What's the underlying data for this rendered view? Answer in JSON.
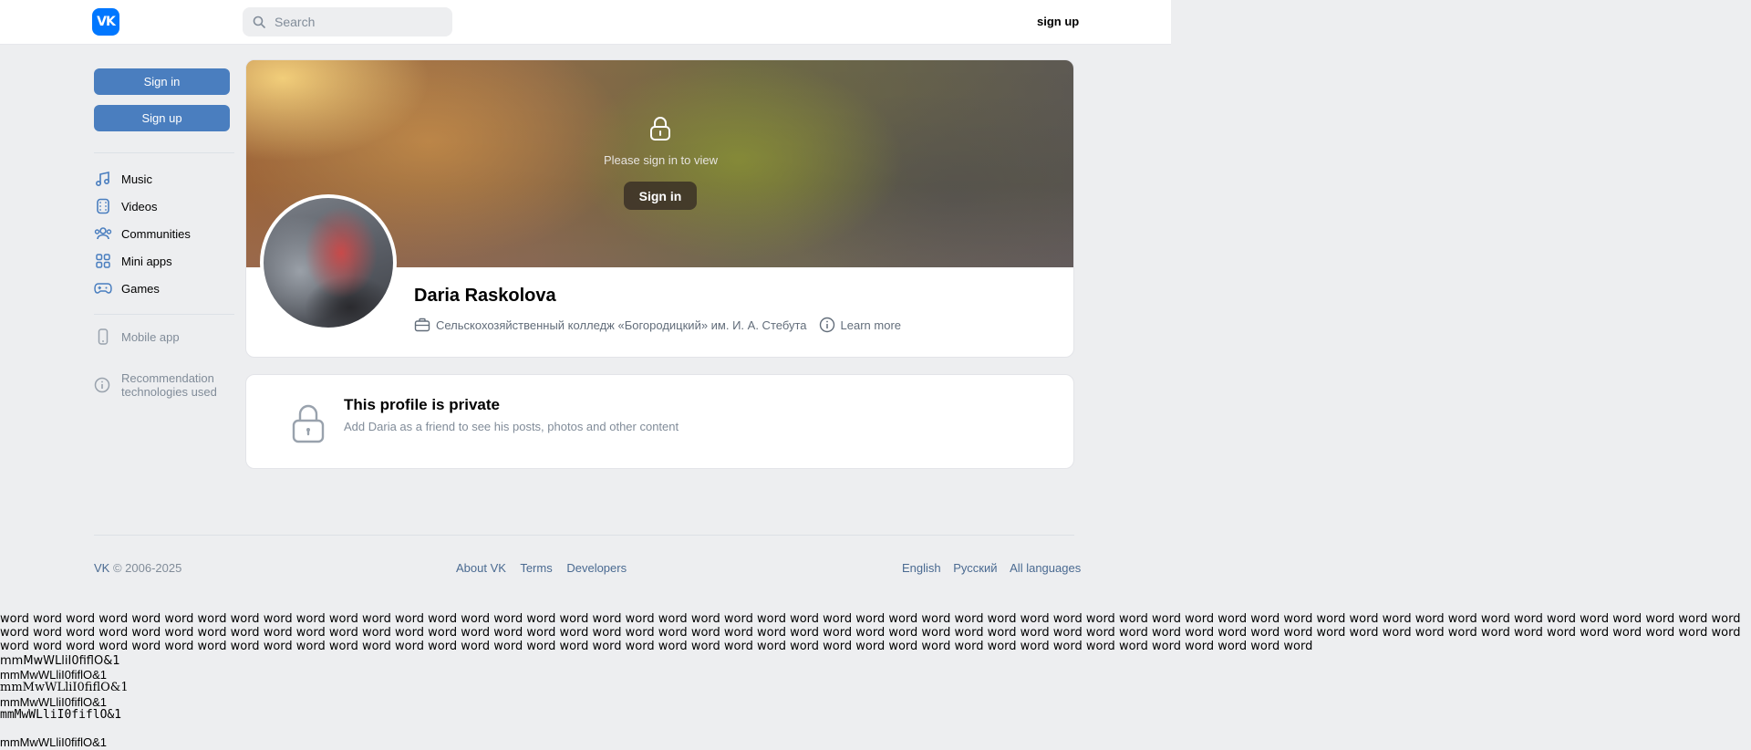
{
  "header": {
    "logo": "VK",
    "search_placeholder": "Search",
    "signup_label": "sign up"
  },
  "sidebar": {
    "signin_label": "Sign in",
    "signup_label": "Sign up",
    "items": [
      {
        "label": "Music",
        "icon": "music-icon"
      },
      {
        "label": "Videos",
        "icon": "video-icon"
      },
      {
        "label": "Communities",
        "icon": "communities-icon"
      },
      {
        "label": "Mini apps",
        "icon": "mini-apps-icon"
      },
      {
        "label": "Games",
        "icon": "gamepad-icon"
      }
    ],
    "mobile_app": "Mobile app",
    "recommendation_line1": "Recommendation",
    "recommendation_line2": "technologies used"
  },
  "profile": {
    "lock_message": "Please sign in to view",
    "cover_signin": "Sign in",
    "name": "Daria Raskolova",
    "workplace": "Сельскохозяйственный колледж «Богородицкий» им. И. А. Стебута",
    "learn_more": "Learn more"
  },
  "private": {
    "title": "This profile is private",
    "subtitle": "Add Daria as a friend to see his posts, photos and other content"
  },
  "footer": {
    "vk": "VK",
    "copyright": "© 2006-2025",
    "about": "About VK",
    "terms": "Terms",
    "developers": "Developers",
    "english": "English",
    "russian": "Русский",
    "all_languages": "All languages"
  },
  "font_probe": {
    "words": "word word word word word word word word word word word word word word word word word word word word word word word word word word word word word word word word word word word word word word word word word word word word word word word word word word word word word word word word word word word word word word word word word word word word word word word word word word word word word word word word word word word word word word word word word word word word word word word word word word word word word word word word word word word word word word word word word word word word word word word word word word word word word word word word word word word word word word word word word word word word word word word word word word",
    "line1": "mmMwWLliI0fiflO&1",
    "line2": "mmMwWLliI0fiflO&1",
    "line3": "mmMwWLliI0fiflO&1",
    "line4": "mmMwWLliI0fiflO&1",
    "line5": "mmMwWLliI0fiflO&1",
    "line6": "mmMwWLliI0fiflO&1"
  },
  "colors": {
    "accent": "#0077ff",
    "button": "#4a7ebf",
    "background": "#edeef0"
  }
}
